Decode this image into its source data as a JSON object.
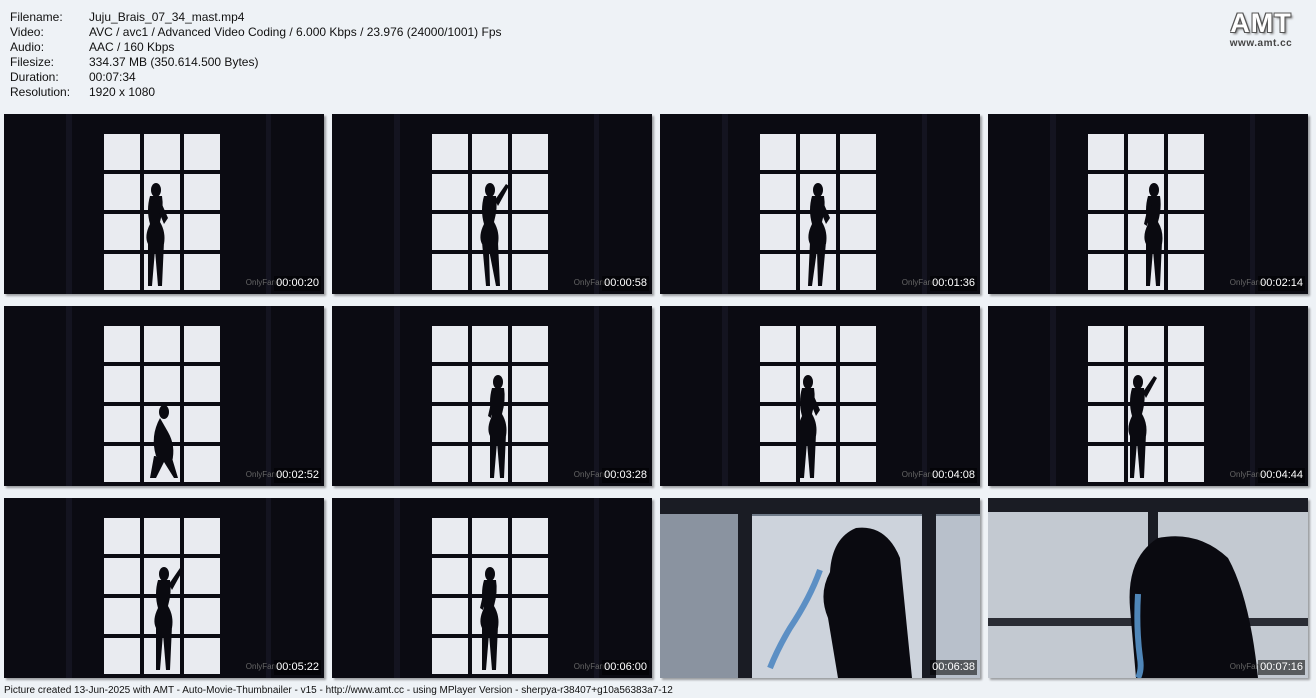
{
  "info": {
    "rows": [
      {
        "key": "Filename:",
        "value": "Juju_Brais_07_34_mast.mp4"
      },
      {
        "key": "Video:",
        "value": "AVC / avc1 / Advanced Video Coding / 6.000 Kbps / 23.976 (24000/1001) Fps"
      },
      {
        "key": "Audio:",
        "value": "AAC / 160 Kbps"
      },
      {
        "key": "Filesize:",
        "value": "334.37 MB (350.614.500 Bytes)"
      },
      {
        "key": "Duration:",
        "value": "00:07:34"
      },
      {
        "key": "Resolution:",
        "value": "1920 x 1080"
      }
    ]
  },
  "logo": {
    "text": "AMT",
    "url": "www.amt.cc"
  },
  "thumbnails": [
    {
      "time": "00:00:20",
      "watermark": "OnlyFans",
      "scene": "window"
    },
    {
      "time": "00:00:58",
      "watermark": "OnlyFans",
      "scene": "window"
    },
    {
      "time": "00:01:36",
      "watermark": "OnlyFans",
      "scene": "window"
    },
    {
      "time": "00:02:14",
      "watermark": "OnlyFans",
      "scene": "window"
    },
    {
      "time": "00:02:52",
      "watermark": "OnlyFans",
      "scene": "window"
    },
    {
      "time": "00:03:28",
      "watermark": "OnlyFans",
      "scene": "window"
    },
    {
      "time": "00:04:08",
      "watermark": "OnlyFans",
      "scene": "window"
    },
    {
      "time": "00:04:44",
      "watermark": "OnlyFans",
      "scene": "window"
    },
    {
      "time": "00:05:22",
      "watermark": "OnlyFans",
      "scene": "window"
    },
    {
      "time": "00:06:00",
      "watermark": "OnlyFans",
      "scene": "window"
    },
    {
      "time": "00:06:38",
      "watermark": "",
      "scene": "closeup"
    },
    {
      "time": "00:07:16",
      "watermark": "OnlyFans",
      "scene": "closeup"
    }
  ],
  "footer": "Picture created 13-Jun-2025 with AMT - Auto-Movie-Thumbnailer - v15 - http://www.amt.cc - using MPlayer Version - sherpya-r38407+g10a56383a7-12",
  "colors": {
    "page_bg": "#eef2f6",
    "frame_bg": "#0b0b12",
    "window_glass": "#e9ebf0",
    "silhouette": "#0a0a10"
  }
}
